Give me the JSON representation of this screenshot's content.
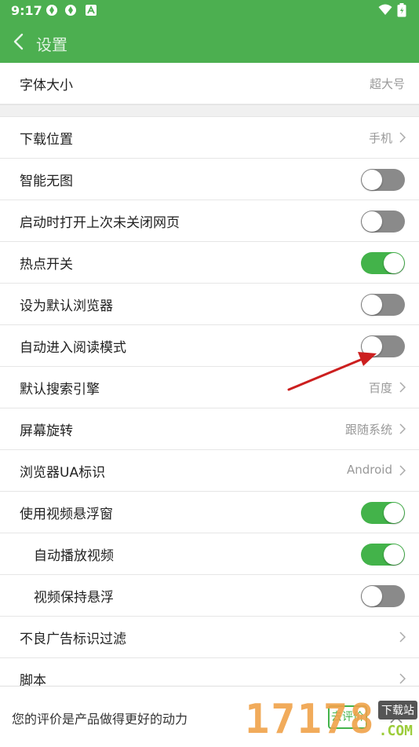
{
  "status_bar": {
    "time": "9:17"
  },
  "header": {
    "title": "设置"
  },
  "font_size": {
    "label": "字体大小",
    "value": "超大号"
  },
  "settings": [
    {
      "label": "下载位置",
      "value": "手机",
      "control": "arrow"
    },
    {
      "label": "智能无图",
      "control": "toggle",
      "on": false
    },
    {
      "label": "启动时打开上次未关闭网页",
      "control": "toggle",
      "on": false
    },
    {
      "label": "热点开关",
      "control": "toggle",
      "on": true
    },
    {
      "label": "设为默认浏览器",
      "control": "toggle",
      "on": false
    },
    {
      "label": "自动进入阅读模式",
      "control": "toggle",
      "on": false
    },
    {
      "label": "默认搜索引擎",
      "value": "百度",
      "control": "arrow"
    },
    {
      "label": "屏幕旋转",
      "value": "跟随系统",
      "control": "arrow"
    },
    {
      "label": "浏览器UA标识",
      "value": "Android",
      "control": "arrow"
    },
    {
      "label": "使用视频悬浮窗",
      "control": "toggle",
      "on": true
    },
    {
      "label": "自动播放视频",
      "control": "toggle",
      "on": true,
      "sub": true
    },
    {
      "label": "视频保持悬浮",
      "control": "toggle",
      "on": false,
      "sub": true
    },
    {
      "label": "不良广告标识过滤",
      "value": "",
      "control": "arrow"
    },
    {
      "label": "脚本",
      "value": "",
      "control": "arrow"
    }
  ],
  "bottom_prompt": {
    "text": "您的评价是产品做得更好的动力",
    "button": "去评价"
  },
  "watermark": {
    "digits": "17178",
    "badge": "下载站",
    "domain": ".COM"
  },
  "colors": {
    "header_green": "#4caf50",
    "toggle_on": "#43b34a",
    "toggle_off": "#8a8a8a",
    "annotation_arrow": "#cc1f1f"
  }
}
